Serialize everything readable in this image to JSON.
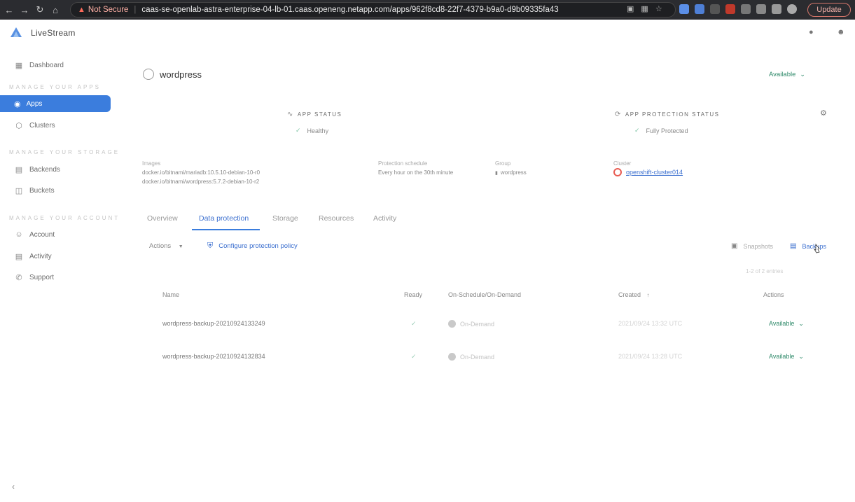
{
  "browser": {
    "security_label": "Not Secure",
    "url": "caas-se-openlab-astra-enterprise-04-lb-01.caas.openeng.netapp.com/apps/962f8cd8-22f7-4379-b9a0-d9b09335fa43",
    "update_label": "Update"
  },
  "header": {
    "brand": "LiveStream"
  },
  "sidebar": {
    "dashboard": "Dashboard",
    "sec_apps": "MANAGE YOUR APPS",
    "apps": "Apps",
    "clusters": "Clusters",
    "sec_storage": "MANAGE YOUR STORAGE",
    "backends": "Backends",
    "buckets": "Buckets",
    "sec_account": "MANAGE YOUR ACCOUNT",
    "account": "Account",
    "activity": "Activity",
    "support": "Support"
  },
  "app": {
    "name": "wordpress",
    "state": "Available",
    "app_status_label": "APP STATUS",
    "app_status_value": "Healthy",
    "protection_label": "APP PROTECTION STATUS",
    "protection_value": "Fully Protected",
    "images_label": "Images",
    "images": [
      "docker.io/bitnami/mariadb:10.5.10-debian-10-r0",
      "docker.io/bitnami/wordpress:5.7.2-debian-10-r2"
    ],
    "schedule_label": "Protection schedule",
    "schedule_value": "Every hour on the 30th minute",
    "group_label": "Group",
    "group_value": "wordpress",
    "cluster_label": "Cluster",
    "cluster_value": "openshift-cluster014"
  },
  "tabs": [
    "Overview",
    "Data protection",
    "Storage",
    "Resources",
    "Activity"
  ],
  "toolbar": {
    "actions": "Actions",
    "configure": "Configure protection policy",
    "snapshots": "Snapshots",
    "backups": "Backups",
    "entries": "1-2 of 2 entries"
  },
  "table": {
    "headers": {
      "name": "Name",
      "ready": "Ready",
      "schedule": "On-Schedule/On-Demand",
      "created": "Created",
      "actions": "Actions"
    },
    "rows": [
      {
        "name": "wordpress-backup-20210924133249",
        "ready": "✓",
        "schedule": "On-Demand",
        "created": "2021/09/24 13:32 UTC",
        "state": "Available"
      },
      {
        "name": "wordpress-backup-20210924132834",
        "ready": "✓",
        "schedule": "On-Demand",
        "created": "2021/09/24 13:28 UTC",
        "state": "Available"
      }
    ]
  },
  "colors": {
    "accent": "#3b7ddd",
    "ok": "#2f8a6a"
  }
}
